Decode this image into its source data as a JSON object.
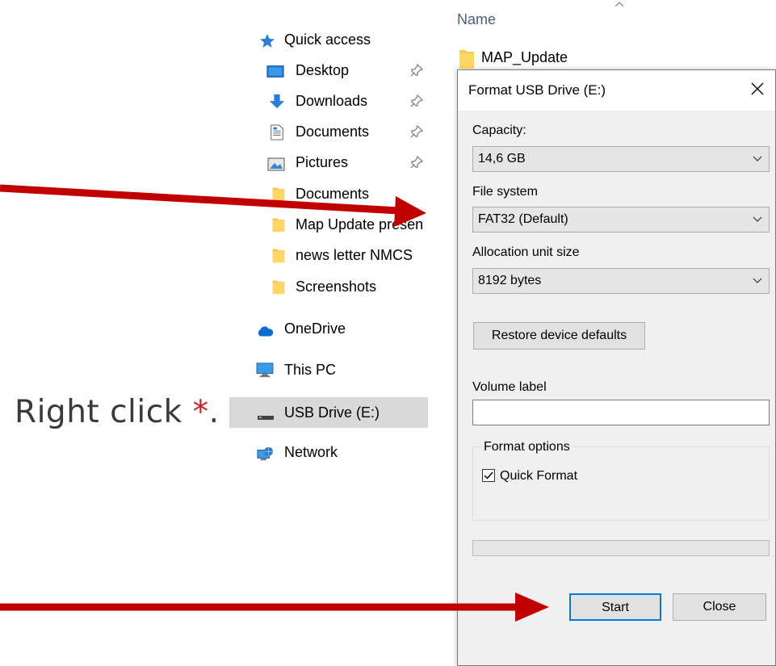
{
  "annotation": {
    "text": "Right click ",
    "star": "*",
    "suffix": "."
  },
  "nav": {
    "quick_access": "Quick access",
    "pinned": [
      {
        "label": "Desktop",
        "icon": "desktop-icon"
      },
      {
        "label": "Downloads",
        "icon": "download-arrow-icon"
      },
      {
        "label": "Documents",
        "icon": "document-icon"
      },
      {
        "label": "Pictures",
        "icon": "picture-icon"
      }
    ],
    "folders": [
      "Documents",
      "Map Update presen",
      "news letter NMCS",
      "Screenshots"
    ],
    "onedrive": "OneDrive",
    "this_pc": "This PC",
    "usb": "USB Drive (E:)",
    "network": "Network"
  },
  "filelist": {
    "column_name": "Name",
    "rows": [
      "MAP_Update"
    ]
  },
  "dialog": {
    "title": "Format USB Drive (E:)",
    "capacity_label": "Capacity:",
    "capacity_value": "14,6 GB",
    "filesystem_label": "File system",
    "filesystem_value": "FAT32 (Default)",
    "alloc_label": "Allocation unit size",
    "alloc_value": "8192 bytes",
    "restore_button": "Restore device defaults",
    "volume_label": "Volume label",
    "volume_value": "",
    "format_options": "Format options",
    "quick_format": "Quick Format",
    "quick_format_checked": true,
    "progress": 0,
    "start_button": "Start",
    "close_button": "Close"
  },
  "colors": {
    "arrow": "#c00000",
    "accent": "#0078d7",
    "selected_row": "#d9d9d9"
  }
}
